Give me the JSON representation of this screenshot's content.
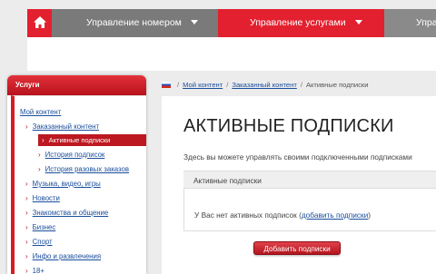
{
  "nav": {
    "items": [
      {
        "label": "Управление номером"
      },
      {
        "label": "Управление услугами"
      },
      {
        "label": "Упра"
      }
    ]
  },
  "sidebar": {
    "header": "Услуги",
    "items": [
      {
        "label": "Мой контент"
      },
      {
        "label": "Заказанный контент"
      },
      {
        "label": "Активные подписки"
      },
      {
        "label": "История подписок"
      },
      {
        "label": "История разовых заказов"
      },
      {
        "label": "Музыка, видео, игры"
      },
      {
        "label": "Новости"
      },
      {
        "label": "Знакомства и общение"
      },
      {
        "label": "Бизнес"
      },
      {
        "label": "Спорт"
      },
      {
        "label": "Инфо и развлечения"
      },
      {
        "label": "18+"
      }
    ]
  },
  "breadcrumb": {
    "items": [
      "Мой контент",
      "Заказанный контент",
      "Активные подписки"
    ],
    "separator": "/"
  },
  "main": {
    "title": "АКТИВНЫЕ ПОДПИСКИ",
    "description": "Здесь вы можете управлять своими подключенными подписками",
    "section_title": "Активные подписки",
    "empty_prefix": "У Вас нет активных подписок (",
    "empty_link": "добавить подписки",
    "empty_suffix": ")",
    "add_button": "Добавить подписки"
  },
  "colors": {
    "accent_red": "#e3202f",
    "nav_gray": "#7a7a7a",
    "link_blue": "#1a4e9c"
  }
}
